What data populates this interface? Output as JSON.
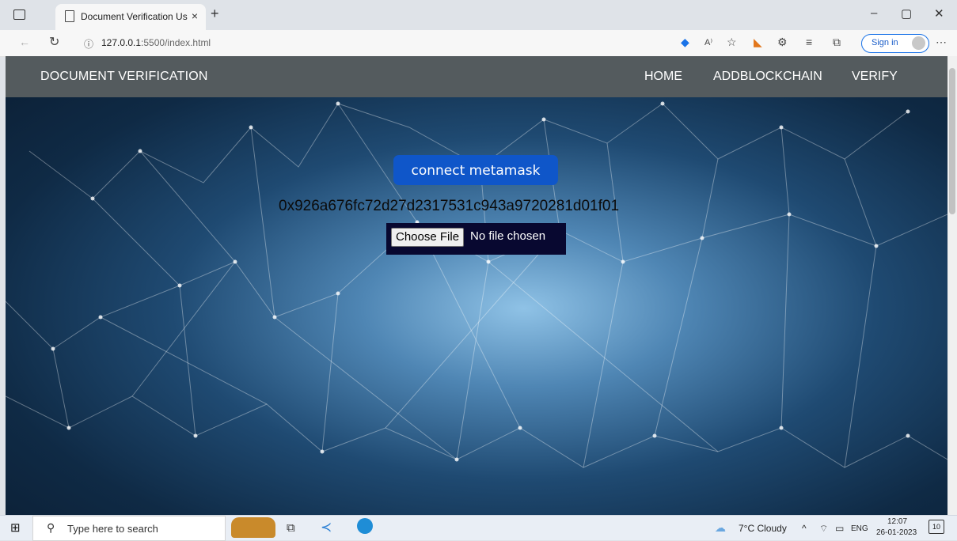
{
  "browser": {
    "tab_title": "Document Verification Using Blo",
    "tab_close": "×",
    "new_tab": "+",
    "url_host": "127.0.0.1",
    "url_rest": ":5500/index.html",
    "signin_label": "Sign in",
    "window_controls": [
      "–",
      "▢",
      "✕"
    ],
    "icons": [
      "back-arrow-icon",
      "refresh-icon",
      "info-icon",
      "tag-icon",
      "read-aloud-icon",
      "favorite-icon",
      "metamask-fox-icon",
      "extensions-icon",
      "favorites-list-icon",
      "collections-icon",
      "more-icon"
    ]
  },
  "site": {
    "brand": "DOCUMENT VERIFICATION",
    "nav": [
      "HOME",
      "ADDBLOCKCHAIN",
      "VERIFY"
    ],
    "connect_button": "connect metamask",
    "account_address": "0x926a676fc72d27d2317531c943a9720281d01f01",
    "file_button": "Choose File",
    "file_status": "No file chosen"
  },
  "taskbar": {
    "search_placeholder": "Type here to search",
    "weather": "7°C  Cloudy",
    "lang": "ENG",
    "time": "12:07",
    "date": "26-01-2023",
    "notifications": "10"
  },
  "colors": {
    "navbar": "#545b5e",
    "connect_button": "#0f56c9",
    "file_panel": "#080830",
    "signin_border": "#1a73e8"
  }
}
